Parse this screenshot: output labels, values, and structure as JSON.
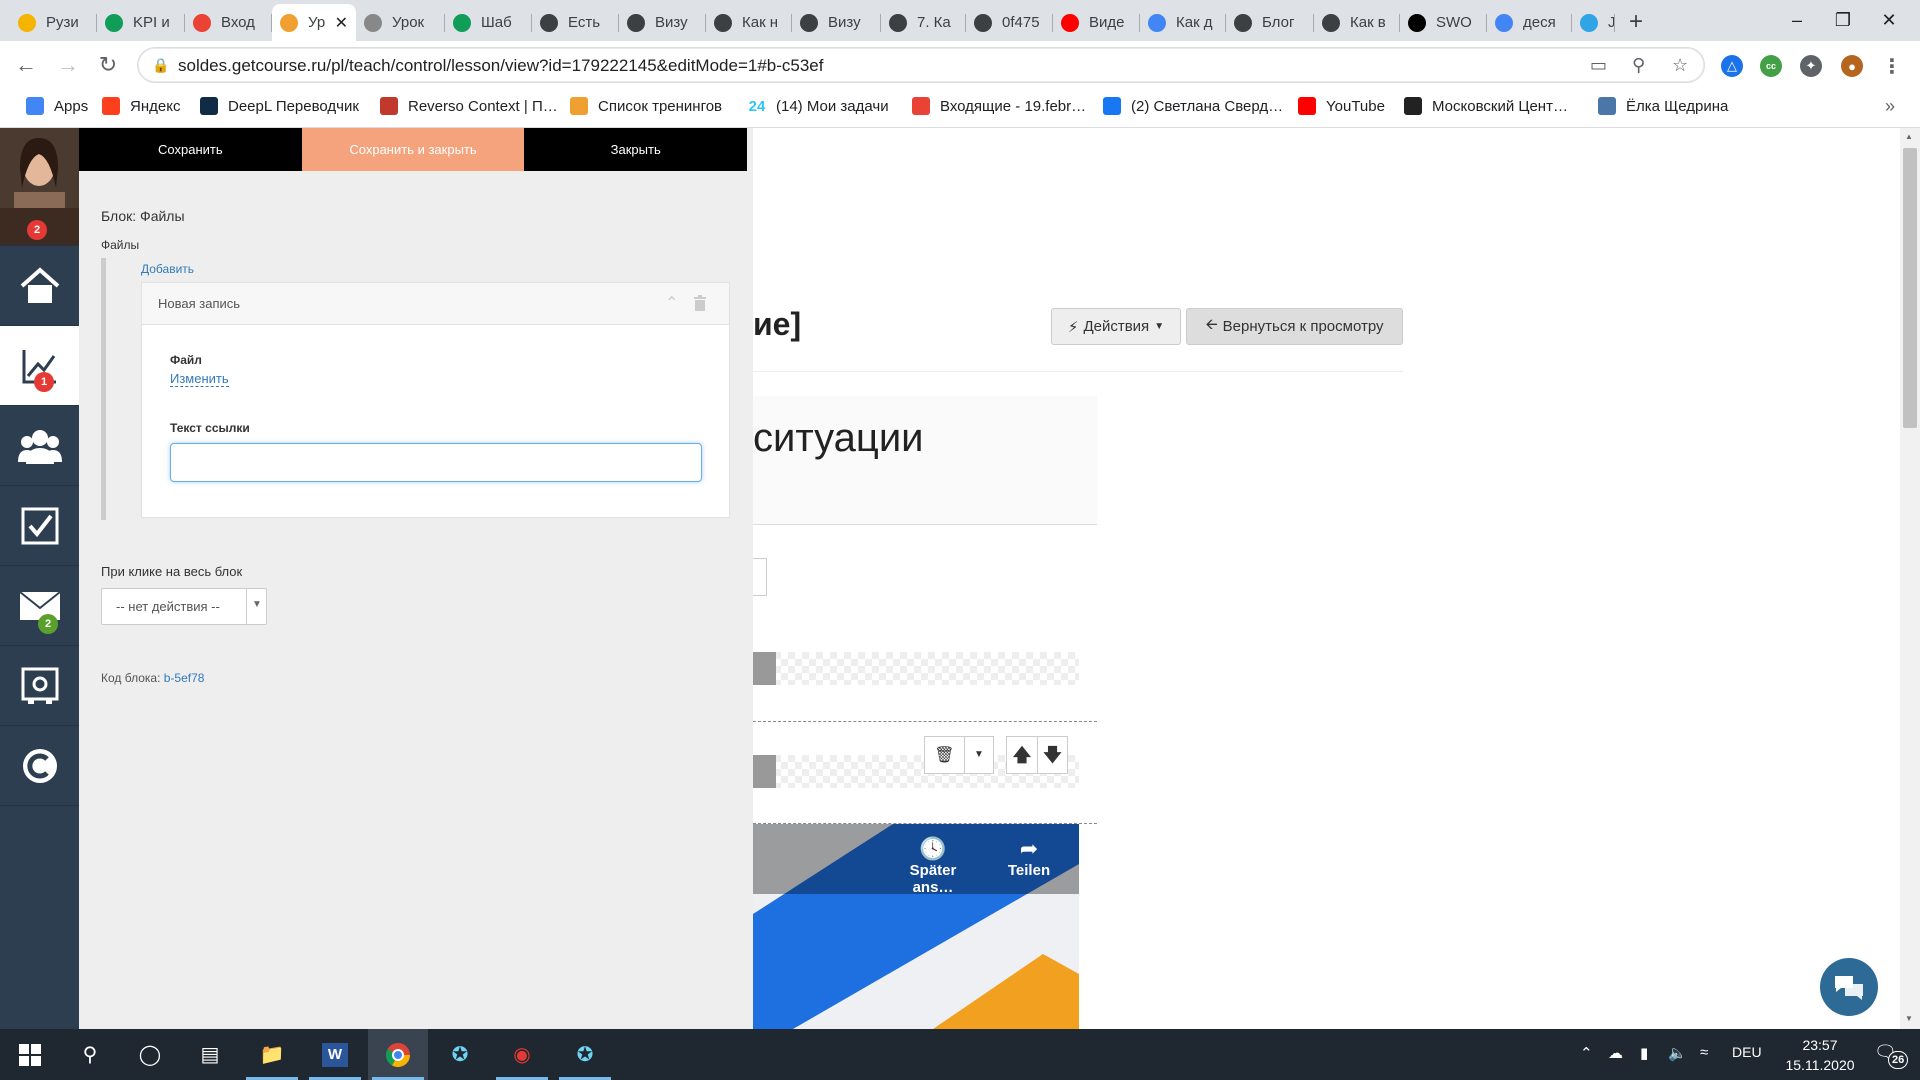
{
  "tabs": [
    {
      "label": "Рузи",
      "icon": "google-drive-icon",
      "color": "#f4b400"
    },
    {
      "label": "KPI и",
      "icon": "sheets-icon",
      "color": "#0f9d58"
    },
    {
      "label": "Вход",
      "icon": "gmail-icon",
      "color": "#ea4335"
    },
    {
      "label": "Ур",
      "icon": "soldes-icon",
      "color": "#f0a030",
      "active": true
    },
    {
      "label": "Урок",
      "icon": "site-icon",
      "color": "#888888"
    },
    {
      "label": "Шаб",
      "icon": "sheets-icon",
      "color": "#0f9d58"
    },
    {
      "label": "Есть",
      "icon": "getcourse-icon",
      "color": "#3c4043"
    },
    {
      "label": "Визу",
      "icon": "getcourse-icon",
      "color": "#3c4043"
    },
    {
      "label": "Как н",
      "icon": "getcourse-icon",
      "color": "#3c4043"
    },
    {
      "label": "Визу",
      "icon": "getcourse-icon",
      "color": "#3c4043"
    },
    {
      "label": "7. Ка",
      "icon": "getcourse-icon",
      "color": "#3c4043"
    },
    {
      "label": "0f475",
      "icon": "getcourse-icon",
      "color": "#3c4043"
    },
    {
      "label": "Виде",
      "icon": "youtube-icon",
      "color": "#ff0000"
    },
    {
      "label": "Как д",
      "icon": "google-icon",
      "color": "#4285f4"
    },
    {
      "label": "Блог",
      "icon": "getcourse-icon",
      "color": "#3c4043"
    },
    {
      "label": "Как в",
      "icon": "getcourse-icon",
      "color": "#3c4043"
    },
    {
      "label": "SWO",
      "icon": "wikipedia-icon",
      "color": "#000000"
    },
    {
      "label": "деся",
      "icon": "google-icon",
      "color": "#4285f4"
    },
    {
      "label": "Joxi",
      "icon": "joxi-icon",
      "color": "#2fa4e7"
    }
  ],
  "omnibox": {
    "url": "soldes.getcourse.ru/pl/teach/control/lesson/view?id=179222145&editMode=1#b-c53ef"
  },
  "bookmarks": [
    {
      "label": "Apps",
      "icon": "apps-icon",
      "color": "#4285f4"
    },
    {
      "label": "Яндекс",
      "icon": "yandex-icon",
      "color": "#fc3f1d"
    },
    {
      "label": "DeepL Переводчик",
      "icon": "deepl-icon",
      "color": "#0f2b46"
    },
    {
      "label": "Reverso Context | П…",
      "icon": "reverso-icon",
      "color": "#c0392b"
    },
    {
      "label": "Список тренингов",
      "icon": "soldes-icon",
      "color": "#f0a030"
    },
    {
      "label": "(14) Мои задачи",
      "icon": "bitrix24-icon",
      "color": "#2fc6f6",
      "glyph": "24"
    },
    {
      "label": "Входящие - 19.febr…",
      "icon": "gmail-icon",
      "color": "#ea4335"
    },
    {
      "label": "(2) Светлана Сверд…",
      "icon": "facebook-icon",
      "color": "#1877f2"
    },
    {
      "label": "YouTube",
      "icon": "youtube-icon",
      "color": "#ff0000"
    },
    {
      "label": "Московский Цент…",
      "icon": "moscow-center-icon",
      "color": "#222222"
    },
    {
      "label": "Ёлка Щедрина",
      "icon": "vk-icon",
      "color": "#4a76a8"
    }
  ],
  "rail": {
    "avatar_badge": "2",
    "items": [
      {
        "name": "home-icon"
      },
      {
        "name": "chart-icon",
        "badge": "1",
        "badge_color": "#e53935"
      },
      {
        "name": "users-icon"
      },
      {
        "name": "tasks-icon"
      },
      {
        "name": "mail-icon",
        "badge": "2",
        "badge_color": "#5aa02c"
      },
      {
        "name": "settings-safe-icon"
      },
      {
        "name": "getcourse-logo-icon"
      }
    ]
  },
  "panel": {
    "save": "Сохранить",
    "save_close": "Сохранить и закрыть",
    "close": "Закрыть",
    "block_title": "Блок: Файлы",
    "files_label": "Файлы",
    "add_link": "Добавить",
    "record_title": "Новая запись",
    "file_label": "Файл",
    "change_link": "Изменить",
    "link_text_label": "Текст ссылки",
    "link_text_value": "",
    "click_label": "При клике на весь блок",
    "click_select": "-- нет действия --",
    "block_code_label": "Код блока:",
    "block_code_value": "b-5ef78"
  },
  "content": {
    "heading_fragment": "ие]",
    "actions_btn": "Действия",
    "back_btn": "Вернуться к просмотру",
    "situations_text": "ситуации",
    "video_later": "Später ans…",
    "video_share": "Teilen"
  },
  "taskbar": {
    "lang": "DEU",
    "time": "23:57",
    "date": "15.11.2020",
    "notifications": "26"
  },
  "colors": {
    "accent_orange": "#f5a37d",
    "rail_bg": "#2c3e50",
    "link_blue": "#337ab7"
  }
}
